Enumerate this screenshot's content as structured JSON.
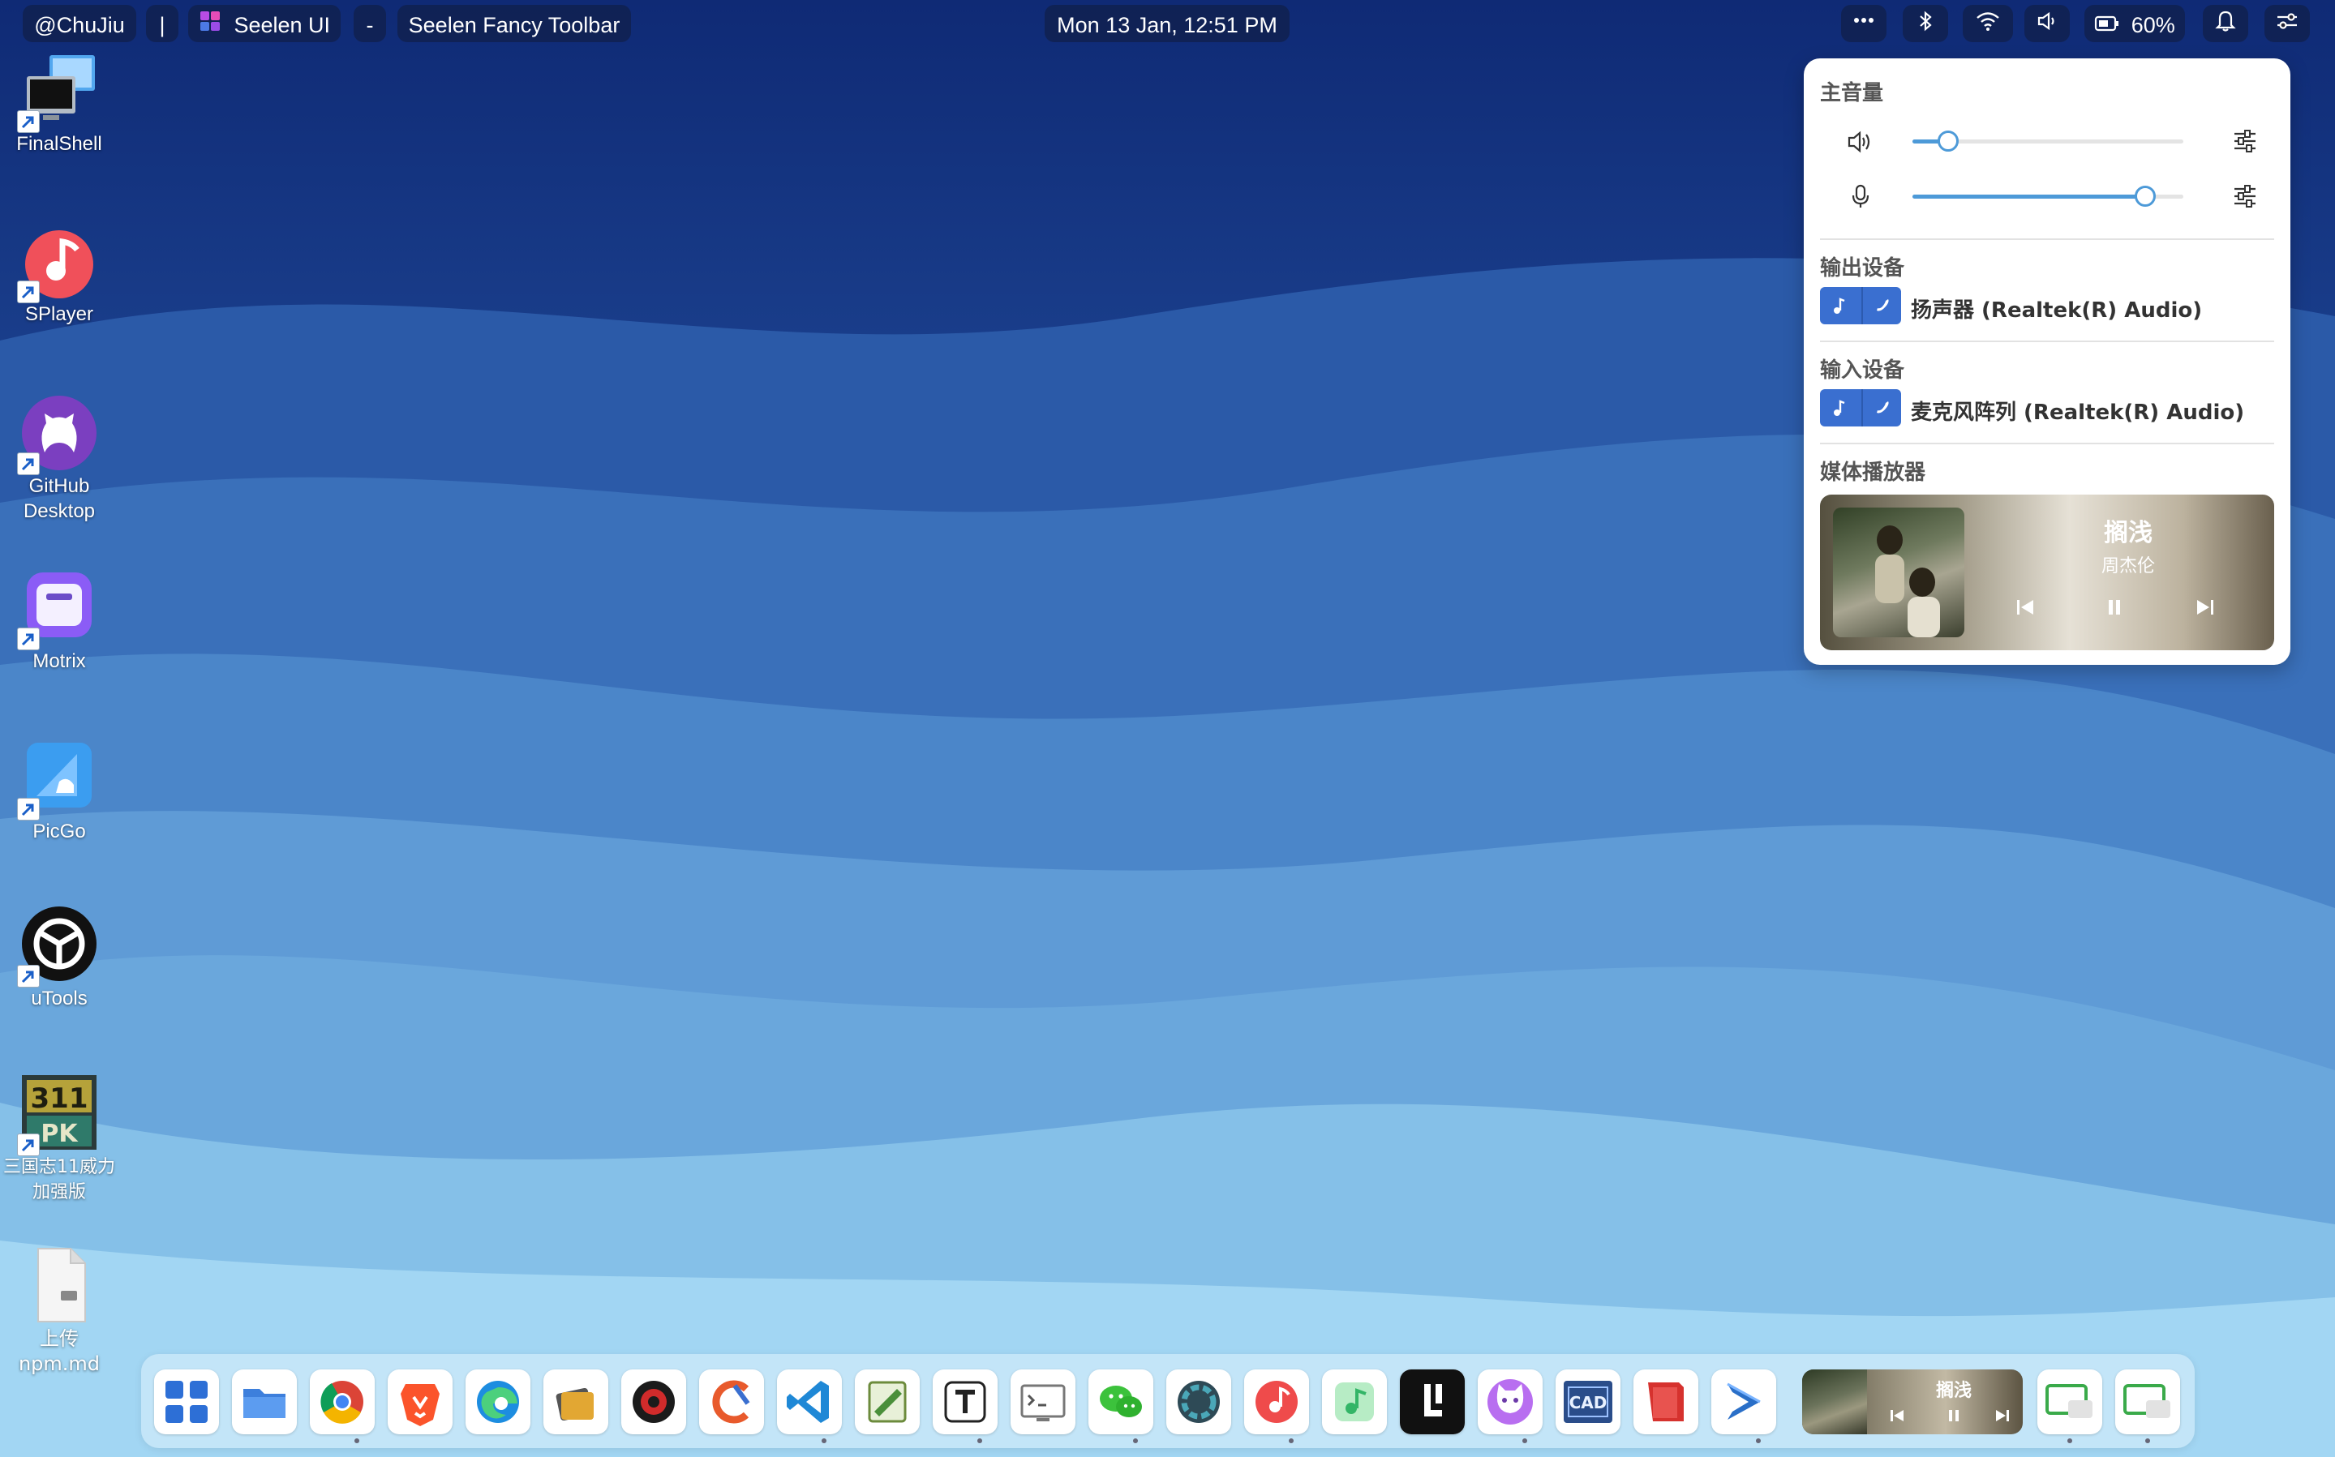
{
  "toolbar": {
    "user_label": "@ChuJiu",
    "separator": "|",
    "app_label": "Seelen UI",
    "dash": "-",
    "window_title": "Seelen Fancy Toolbar",
    "datetime": "Mon 13 Jan, 12:51 PM",
    "battery_percent": "60%",
    "icons": [
      "more-icon",
      "bluetooth-icon",
      "wifi-icon",
      "volume-icon",
      "battery-icon",
      "bell-icon",
      "settings-icon"
    ]
  },
  "desktop_icons": [
    {
      "id": "finalshell",
      "label": "FinalShell"
    },
    {
      "id": "splayer",
      "label": "SPlayer"
    },
    {
      "id": "github-desktop",
      "label": "GitHub Desktop"
    },
    {
      "id": "motrix",
      "label": "Motrix"
    },
    {
      "id": "picgo",
      "label": "PicGo"
    },
    {
      "id": "utools",
      "label": "uTools"
    },
    {
      "id": "sanguozhi",
      "label": "三国志11威力加强版"
    },
    {
      "id": "npm-md",
      "label": "上传npm.md"
    }
  ],
  "audio_panel": {
    "master_title": "主音量",
    "output_volume": 0.1,
    "input_volume": 0.89,
    "output_title": "输出设备",
    "output_device": "扬声器 (Realtek(R) Audio)",
    "input_title": "输入设备",
    "input_device": "麦克风阵列 (Realtek(R) Audio)",
    "media_title": "媒体播放器",
    "media": {
      "song": "搁浅",
      "artist": "周杰伦"
    }
  },
  "dock": {
    "apps": [
      "start-menu",
      "file-explorer",
      "chrome",
      "brave",
      "edge",
      "app-6",
      "app-7",
      "ccleaner",
      "vscode",
      "editor",
      "typora",
      "terminal",
      "wechat",
      "obs",
      "netease-music",
      "qq-music",
      "lighting",
      "cat-app",
      "cad",
      "wps",
      "powershell"
    ],
    "media_song": "搁浅",
    "tail_apps": [
      "remote-desktop-1",
      "remote-desktop-2"
    ]
  },
  "colors": {
    "accent": "#4d9ad8",
    "device_button": "#3a6fd0",
    "panel_bg": "#ffffff"
  }
}
